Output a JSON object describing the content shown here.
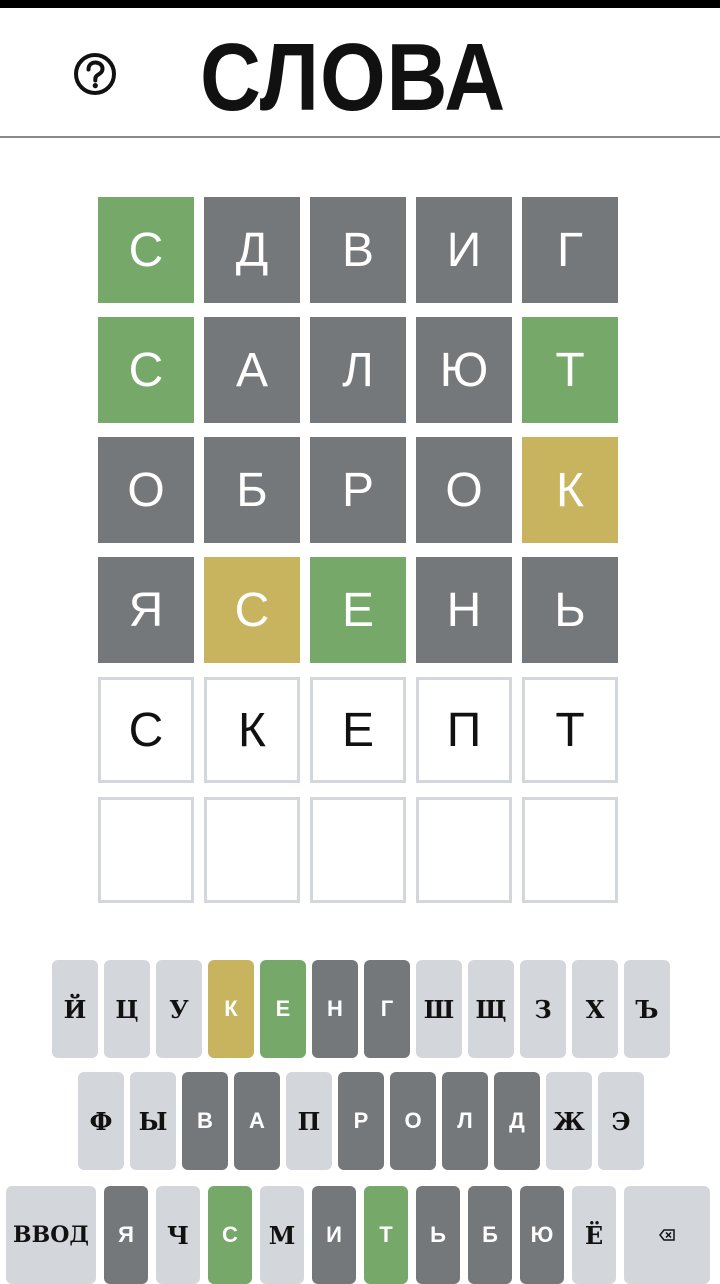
{
  "header": {
    "title": "СЛОВА",
    "help_icon": "help-circle-icon"
  },
  "colors": {
    "correct": "#76a86a",
    "present": "#c8b45e",
    "absent": "#75787a",
    "empty_border": "#d3d6da",
    "key_default": "#d3d6da"
  },
  "board": {
    "rows": [
      [
        {
          "letter": "С",
          "state": "correct"
        },
        {
          "letter": "Д",
          "state": "absent"
        },
        {
          "letter": "В",
          "state": "absent"
        },
        {
          "letter": "И",
          "state": "absent"
        },
        {
          "letter": "Г",
          "state": "absent"
        }
      ],
      [
        {
          "letter": "С",
          "state": "correct"
        },
        {
          "letter": "А",
          "state": "absent"
        },
        {
          "letter": "Л",
          "state": "absent"
        },
        {
          "letter": "Ю",
          "state": "absent"
        },
        {
          "letter": "Т",
          "state": "correct"
        }
      ],
      [
        {
          "letter": "О",
          "state": "absent"
        },
        {
          "letter": "Б",
          "state": "absent"
        },
        {
          "letter": "Р",
          "state": "absent"
        },
        {
          "letter": "О",
          "state": "absent"
        },
        {
          "letter": "К",
          "state": "present"
        }
      ],
      [
        {
          "letter": "Я",
          "state": "absent"
        },
        {
          "letter": "С",
          "state": "present"
        },
        {
          "letter": "Е",
          "state": "correct"
        },
        {
          "letter": "Н",
          "state": "absent"
        },
        {
          "letter": "Ь",
          "state": "absent"
        }
      ],
      [
        {
          "letter": "С",
          "state": "typed"
        },
        {
          "letter": "К",
          "state": "typed"
        },
        {
          "letter": "Е",
          "state": "typed"
        },
        {
          "letter": "П",
          "state": "typed"
        },
        {
          "letter": "Т",
          "state": "typed"
        }
      ],
      [
        {
          "letter": "",
          "state": "empty"
        },
        {
          "letter": "",
          "state": "empty"
        },
        {
          "letter": "",
          "state": "empty"
        },
        {
          "letter": "",
          "state": "empty"
        },
        {
          "letter": "",
          "state": "empty"
        }
      ]
    ]
  },
  "keyboard": {
    "rows": [
      [
        {
          "label": "Й",
          "state": "default"
        },
        {
          "label": "Ц",
          "state": "default"
        },
        {
          "label": "У",
          "state": "default"
        },
        {
          "label": "К",
          "state": "present"
        },
        {
          "label": "Е",
          "state": "correct"
        },
        {
          "label": "Н",
          "state": "absent"
        },
        {
          "label": "Г",
          "state": "absent"
        },
        {
          "label": "Ш",
          "state": "default"
        },
        {
          "label": "Щ",
          "state": "default"
        },
        {
          "label": "З",
          "state": "default"
        },
        {
          "label": "Х",
          "state": "default"
        },
        {
          "label": "Ъ",
          "state": "default"
        }
      ],
      [
        {
          "label": "Ф",
          "state": "default"
        },
        {
          "label": "Ы",
          "state": "default"
        },
        {
          "label": "В",
          "state": "absent"
        },
        {
          "label": "А",
          "state": "absent"
        },
        {
          "label": "П",
          "state": "default"
        },
        {
          "label": "Р",
          "state": "absent"
        },
        {
          "label": "О",
          "state": "absent"
        },
        {
          "label": "Л",
          "state": "absent"
        },
        {
          "label": "Д",
          "state": "absent"
        },
        {
          "label": "Ж",
          "state": "default"
        },
        {
          "label": "Э",
          "state": "default"
        }
      ],
      [
        {
          "label": "ВВОД",
          "state": "default",
          "kind": "enter"
        },
        {
          "label": "Я",
          "state": "absent"
        },
        {
          "label": "Ч",
          "state": "default"
        },
        {
          "label": "С",
          "state": "correct"
        },
        {
          "label": "М",
          "state": "default"
        },
        {
          "label": "И",
          "state": "absent"
        },
        {
          "label": "Т",
          "state": "correct"
        },
        {
          "label": "Ь",
          "state": "absent"
        },
        {
          "label": "Б",
          "state": "absent"
        },
        {
          "label": "Ю",
          "state": "absent"
        },
        {
          "label": "Ё",
          "state": "default"
        },
        {
          "label": "",
          "state": "default",
          "kind": "backspace",
          "icon": "backspace-icon"
        }
      ]
    ]
  }
}
